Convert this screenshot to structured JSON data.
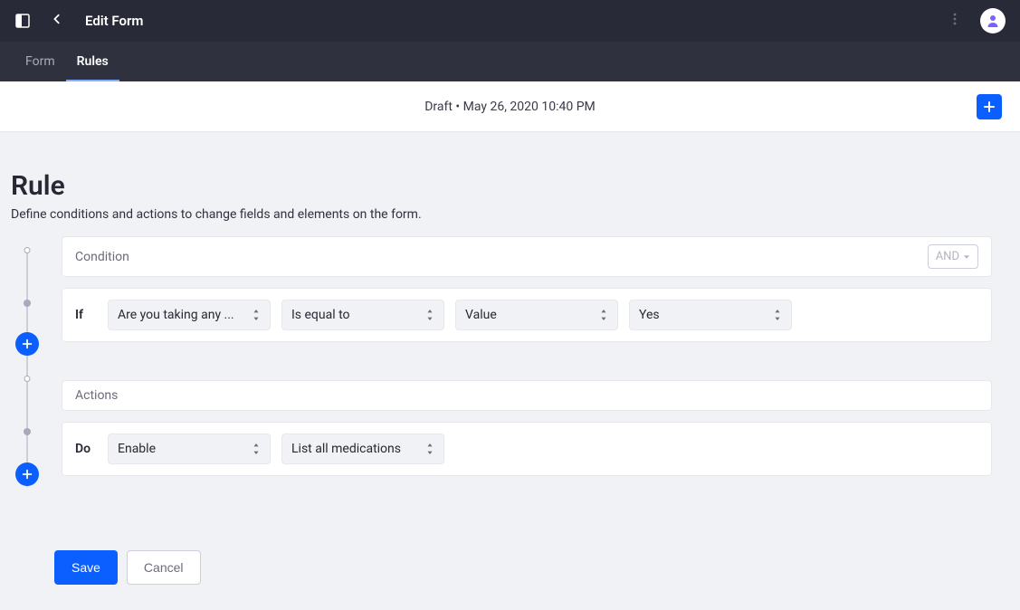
{
  "header": {
    "title": "Edit Form"
  },
  "tabs": {
    "form": "Form",
    "rules": "Rules"
  },
  "statusbar": {
    "status": "Draft • May 26, 2020 10:40 PM"
  },
  "rule": {
    "heading": "Rule",
    "subheading": "Define conditions and actions to change fields and elements on the form.",
    "condition_label": "Condition",
    "and_label": "AND",
    "if_label": "If",
    "if_field": "Are you taking any ...",
    "if_operator": "Is equal to",
    "if_value_type": "Value",
    "if_value": "Yes",
    "actions_label": "Actions",
    "do_label": "Do",
    "do_action": "Enable",
    "do_target": "List all medications"
  },
  "buttons": {
    "save": "Save",
    "cancel": "Cancel"
  }
}
